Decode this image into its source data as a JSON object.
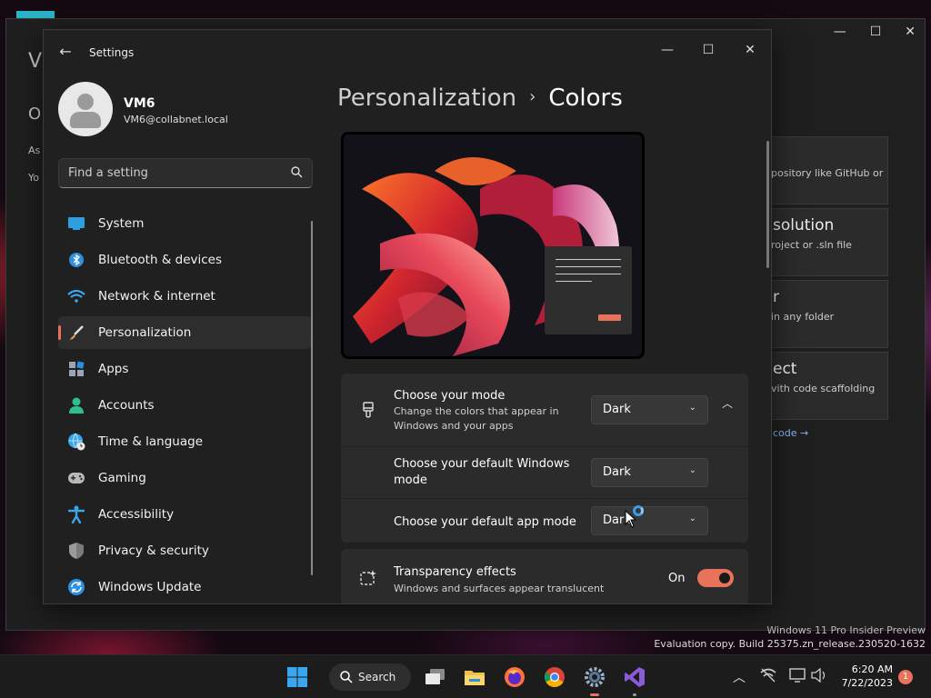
{
  "background_window": {
    "title_fragment": "Vi",
    "heading_fragment": "O",
    "line1_fragment": "As",
    "line2_fragment": "Yo",
    "cards": [
      {
        "title": "",
        "desc": "pository like GitHub or"
      },
      {
        "title": "solution",
        "desc": "roject or .sln file"
      },
      {
        "title": "r",
        "desc": "in any folder"
      },
      {
        "title": "ect",
        "desc": "vith code scaffolding"
      }
    ],
    "link": "code →",
    "watermark_line1": "Windows 11 Pro Insider Preview",
    "watermark_line2": "Evaluation copy. Build 25375.zn_release.230520-1632"
  },
  "settings": {
    "window_title": "Settings",
    "profile": {
      "name": "VM6",
      "email": "VM6@collabnet.local"
    },
    "search": {
      "placeholder": "Find a setting"
    },
    "nav": [
      {
        "label": "System",
        "icon": "system-icon"
      },
      {
        "label": "Bluetooth & devices",
        "icon": "bluetooth-icon"
      },
      {
        "label": "Network & internet",
        "icon": "wifi-icon"
      },
      {
        "label": "Personalization",
        "icon": "brush-icon",
        "active": true
      },
      {
        "label": "Apps",
        "icon": "apps-icon"
      },
      {
        "label": "Accounts",
        "icon": "account-icon"
      },
      {
        "label": "Time & language",
        "icon": "globe-clock-icon"
      },
      {
        "label": "Gaming",
        "icon": "gamepad-icon"
      },
      {
        "label": "Accessibility",
        "icon": "accessibility-icon"
      },
      {
        "label": "Privacy & security",
        "icon": "shield-icon"
      },
      {
        "label": "Windows Update",
        "icon": "update-icon"
      }
    ],
    "breadcrumb": {
      "parent": "Personalization",
      "separator": "›",
      "current": "Colors"
    },
    "mode": {
      "title": "Choose your mode",
      "desc_line1": "Change the colors that appear in",
      "desc_line2": "Windows and your apps",
      "value": "Dark"
    },
    "windows_mode": {
      "title_line1": "Choose your default Windows",
      "title_line2": "mode",
      "value": "Dark"
    },
    "app_mode": {
      "title": "Choose your default app mode",
      "value": "Dark"
    },
    "transparency": {
      "title": "Transparency effects",
      "desc": "Windows and surfaces appear translucent",
      "state_label": "On",
      "on": true
    }
  },
  "taskbar": {
    "search_label": "Search",
    "time": "6:20 AM",
    "date": "7/22/2023",
    "notifications": "1"
  },
  "colors": {
    "accent": "#e8735a",
    "window_bg": "#202020",
    "card_bg": "#2b2b2b"
  }
}
